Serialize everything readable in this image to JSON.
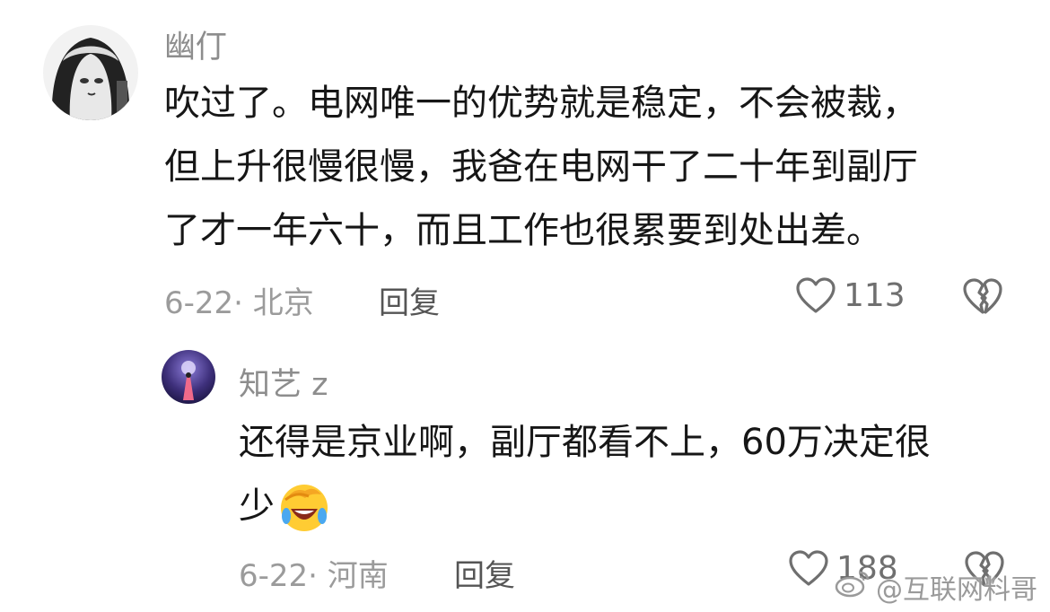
{
  "comments": [
    {
      "username": "幽仃",
      "text_lines": [
        "吹过了。电网唯一的优势就是稳定，不会被裁，",
        "但上升很慢很慢，我爸在电网干了二十年到副厅",
        "了才一年六十，而且工作也很累要到处出差。"
      ],
      "meta": "6-22· 北京",
      "reply_label": "回复",
      "like_count": "113"
    },
    {
      "username": "知艺 z",
      "text_lines": [
        "还得是京业啊，副厅都看不上，60万决定很",
        "少"
      ],
      "emoji": "laughing-crying-emoji",
      "meta": "6-22· 河南",
      "reply_label": "回复",
      "like_count": "188"
    }
  ],
  "watermark": "@互联网料哥",
  "icons": {
    "like": "heart-outline-icon",
    "dislike": "broken-heart-icon",
    "watermark": "weibo-logo-icon"
  },
  "colors": {
    "username": "#8d8d8d",
    "meta": "#9b9b9b",
    "icon": "#6f6f6f"
  }
}
